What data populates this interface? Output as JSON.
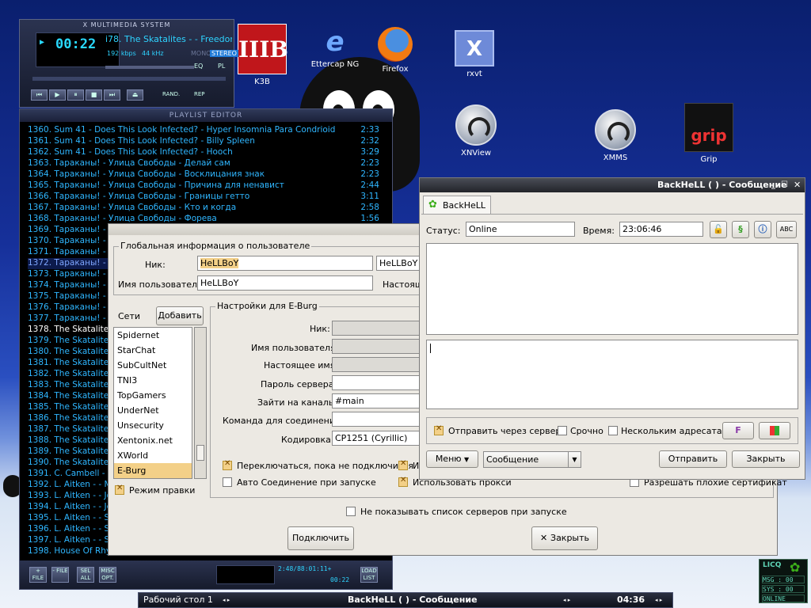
{
  "desktop": {
    "icons": [
      {
        "name": "K3B"
      },
      {
        "name": "Ettercap NG"
      },
      {
        "name": "Firefox"
      },
      {
        "name": "rxvt"
      },
      {
        "name": "XNView"
      },
      {
        "name": "XMMS"
      },
      {
        "name": "Grip"
      }
    ]
  },
  "xmms": {
    "title": "X MULTIMEDIA SYSTEM",
    "time": "00:22",
    "song": "i78. The Skatalites -  - Freedom",
    "kbps": "192 kbps",
    "khz": "44 kHz",
    "mono": "MONO",
    "stereo": "STEREO",
    "eq": "EQ",
    "pl": "PL",
    "rand": "RAND.",
    "rep": "REP"
  },
  "playlist": {
    "title": "PLAYLIST EDITOR",
    "rows": [
      {
        "t": "1360. Sum 41 - Does This Look Infected? - Hyper Insomnia Para Condrioid",
        "d": "2:33"
      },
      {
        "t": "1361. Sum 41 - Does This Look Infected? - Billy Spleen",
        "d": "2:32"
      },
      {
        "t": "1362. Sum 41 - Does This Look Infected? - Hooch",
        "d": "3:29"
      },
      {
        "t": "1363. Тараканы! - Улица Свободы - Делай сам",
        "d": "2:23"
      },
      {
        "t": "1364. Тараканы! - Улица Свободы - Восклицания знак",
        "d": "2:23"
      },
      {
        "t": "1365. Тараканы! - Улица Свободы - Причина для ненавист",
        "d": "2:44"
      },
      {
        "t": "1366. Тараканы! - Улица Свободы - Границы гетто",
        "d": "3:11"
      },
      {
        "t": "1367. Тараканы! - Улица Свободы - Кто и когда",
        "d": "2:58"
      },
      {
        "t": "1368. Тараканы! - Улица Свободы - Форева",
        "d": "1:56"
      },
      {
        "t": "1369. Тараканы! - У",
        "d": ""
      },
      {
        "t": "1370. Тараканы! - У",
        "d": ""
      },
      {
        "t": "1371. Тараканы! - У",
        "d": ""
      },
      {
        "t": "1372. Тараканы! - У",
        "d": ""
      },
      {
        "t": "1373. Тараканы! - У",
        "d": ""
      },
      {
        "t": "1374. Тараканы! - У",
        "d": ""
      },
      {
        "t": "1375. Тараканы! - У",
        "d": ""
      },
      {
        "t": "1376. Тараканы! - У",
        "d": ""
      },
      {
        "t": "1377. Тараканы! - У",
        "d": ""
      },
      {
        "t": "1378. The Skatalites",
        "d": ""
      },
      {
        "t": "1379. The Skatalites",
        "d": ""
      },
      {
        "t": "1380. The Skatalites",
        "d": ""
      },
      {
        "t": "1381. The Skatalites",
        "d": ""
      },
      {
        "t": "1382. The Skatalites",
        "d": ""
      },
      {
        "t": "1383. The Skatalites",
        "d": ""
      },
      {
        "t": "1384. The Skatalites",
        "d": ""
      },
      {
        "t": "1385. The Skatalites",
        "d": ""
      },
      {
        "t": "1386. The Skatalites",
        "d": ""
      },
      {
        "t": "1387. The Skatalites",
        "d": ""
      },
      {
        "t": "1388. The Skatalites",
        "d": ""
      },
      {
        "t": "1389. The Skatalites",
        "d": ""
      },
      {
        "t": "1390. The Skatalites",
        "d": ""
      },
      {
        "t": "1391. C. Cambell - ",
        "d": ""
      },
      {
        "t": "1392. L. Aitken - - M",
        "d": ""
      },
      {
        "t": "1393. L. Aitken - - Jo",
        "d": ""
      },
      {
        "t": "1394. L. Aitken - - Je",
        "d": ""
      },
      {
        "t": "1395. L. Aitken - - Sa",
        "d": ""
      },
      {
        "t": "1396. L. Aitken - - Sk",
        "d": ""
      },
      {
        "t": "1397. L. Aitken - - Sk",
        "d": ""
      },
      {
        "t": "1398. House Of Rhyth",
        "d": ""
      }
    ],
    "current_index": 18,
    "selected_index": 12,
    "buttons": {
      "add": "+ FILE",
      "remove": "- FILE",
      "select": "SEL ALL",
      "misc": "MISC OPT.",
      "list": "LOAD LIST"
    },
    "total": "2:48/88:01:11+",
    "elapsed": "00:22"
  },
  "settings": {
    "group_global": "Глобальная информация о пользователе",
    "nick_label": "Ник:",
    "nick_value": "HeLLBoY",
    "nick_value2": "HeLLBoY",
    "user_label": "Имя пользователя:",
    "user_value": "HeLLBoY",
    "real_label_trunc": "Настоящ",
    "networks_label": "Сети",
    "add_button": "Добавить",
    "networks": [
      "Spidernet",
      "StarChat",
      "SubCultNet",
      "TNI3",
      "TopGamers",
      "UnderNet",
      "Unsecurity",
      "Xentonix.net",
      "XWorld",
      "E-Burg"
    ],
    "selected_network": "E-Burg",
    "edit_mode": "Режим правки",
    "group_net": "Настройки для  E-Burg",
    "f_nick": "Ник:",
    "f_user": "Имя пользователя:",
    "f_real": "Настоящее имя:",
    "f_pass": "Пароль сервера:",
    "f_chan": "Зайти на каналы:",
    "f_chan_value": "#main",
    "f_cmd": "Команда для соединения:",
    "f_enc": "Кодировка:",
    "f_enc_value": "CP1251 (Cyrillic)",
    "cb_cycle": "Переключаться, пока не подключится",
    "cb_cycle2": "И",
    "cb_auto": "Авто Соединение при запуске",
    "cb_proxy": "Использовать прокси",
    "cb_badcert": "Разрешать плохие сертификат",
    "cb_hide": "Не показывать список серверов при запуске",
    "connect": "Подключить",
    "close": "Закрыть"
  },
  "licq": {
    "title": "BackHeLL ( ) - Сообщение",
    "tab": "BackHeLL",
    "status_label": "Статус:",
    "status_value": "Online",
    "time_label": "Время:",
    "time_value": "23:06:46",
    "abc": "ABC",
    "cb_server": "Отправить через сервер",
    "cb_urgent": "Срочно",
    "cb_multi": "Нескольким адресатам",
    "menu": "Меню",
    "type": "Сообщение",
    "send": "Отправить",
    "close": "Закрыть"
  },
  "taskbar": {
    "desktop": "Рабочий стол 1",
    "window": "BackHeLL ( ) - Сообщение",
    "clock": "04:36"
  },
  "gkrellm": {
    "logo": "LICQ",
    "msg": "MSG : 00",
    "sys": "SYS : 00",
    "status": "ONLINE"
  }
}
